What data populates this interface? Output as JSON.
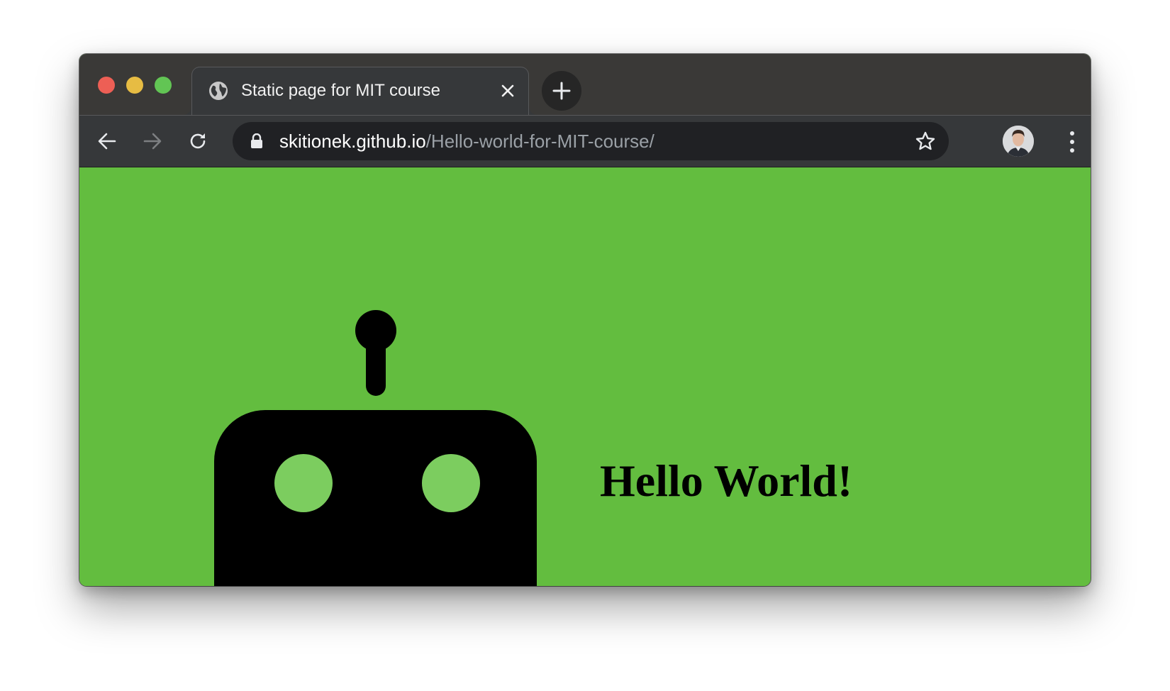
{
  "window": {
    "controls": [
      "close",
      "minimize",
      "zoom"
    ]
  },
  "tab": {
    "title": "Static page for MIT course",
    "icon": "globe-icon",
    "close_icon": "close-icon"
  },
  "new_tab": {
    "icon": "plus-icon"
  },
  "toolbar": {
    "back_icon": "arrow-left-icon",
    "forward_icon": "arrow-right-icon",
    "reload_icon": "reload-icon",
    "lock_icon": "lock-icon",
    "url_host": "skitionek.github.io",
    "url_path": "/Hello-world-for-MIT-course/",
    "bookmark_icon": "star-icon",
    "profile_icon": "avatar",
    "menu_icon": "kebab-menu-icon"
  },
  "page": {
    "background": "#63bd3f",
    "heading": "Hello World!",
    "robot": {
      "color": "#000000",
      "eye_color": "#7ccd5f"
    }
  },
  "colors": {
    "titlebar": "#3a3937",
    "tab": "#36383a",
    "omnibox": "#202124",
    "close_light": "#ed5f55",
    "minimize_light": "#e7bc43",
    "zoom_light": "#62c554"
  }
}
